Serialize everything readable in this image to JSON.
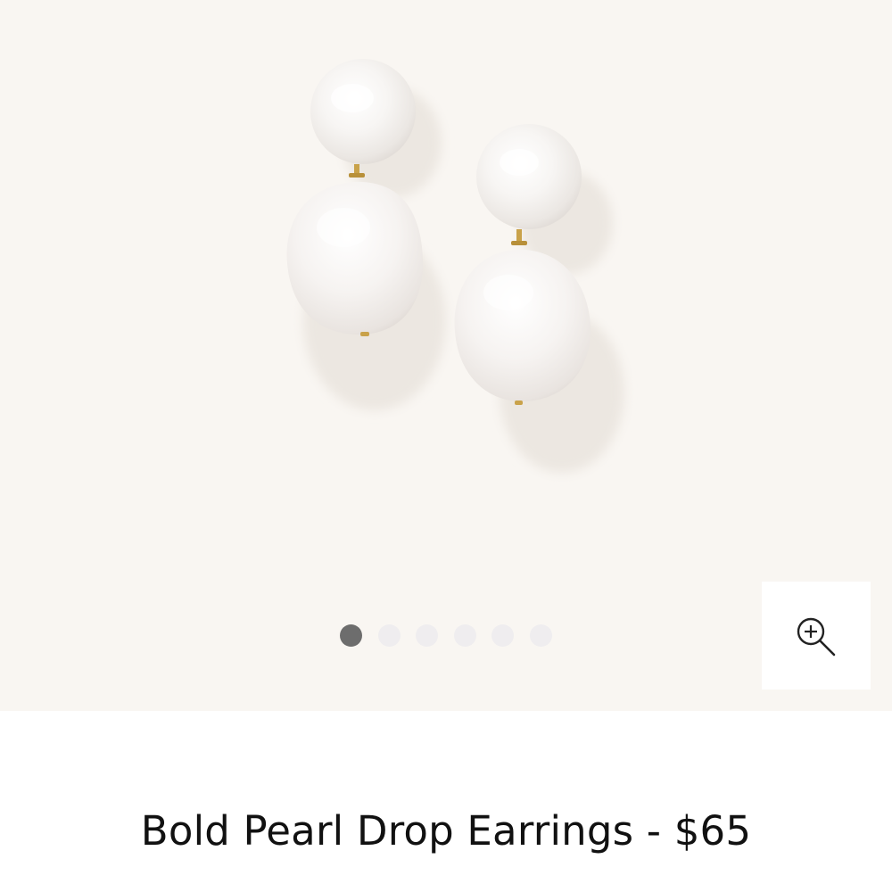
{
  "product": {
    "title": "Bold Pearl Drop Earrings - $65",
    "image_alt": "Bold Pearl Drop Earrings"
  },
  "gallery": {
    "slide_count": 6,
    "active_index": 0,
    "background_color": "#f9f6f2",
    "dot_active_color": "#6d6d6d",
    "dot_inactive_color": "#efedef",
    "zoom_icon": "zoom-in-icon"
  }
}
